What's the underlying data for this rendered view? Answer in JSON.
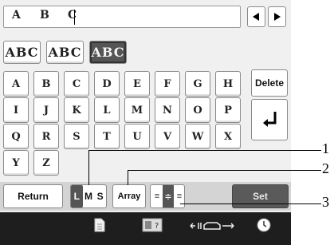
{
  "text_display": {
    "chars": [
      "A",
      "B",
      "C"
    ]
  },
  "font_tabs": [
    {
      "label": "ABC",
      "selected": false
    },
    {
      "label": "ABC",
      "selected": false
    },
    {
      "label": "ABC",
      "selected": true
    }
  ],
  "keys": [
    [
      "A",
      "B",
      "C",
      "D",
      "E",
      "F",
      "G",
      "H"
    ],
    [
      "I",
      "J",
      "K",
      "L",
      "M",
      "N",
      "O",
      "P"
    ],
    [
      "Q",
      "R",
      "S",
      "T",
      "U",
      "V",
      "W",
      "X"
    ],
    [
      "Y",
      "Z"
    ]
  ],
  "delete_label": "Delete",
  "return_label": "Return",
  "size_options": [
    "L",
    "M",
    "S"
  ],
  "size_selected": "L",
  "array_label": "Array",
  "set_label": "Set",
  "callouts": [
    "1",
    "2",
    "3"
  ],
  "status_icons": [
    "page-icon",
    "help-icon",
    "presser-foot-icon",
    "clock-icon"
  ]
}
